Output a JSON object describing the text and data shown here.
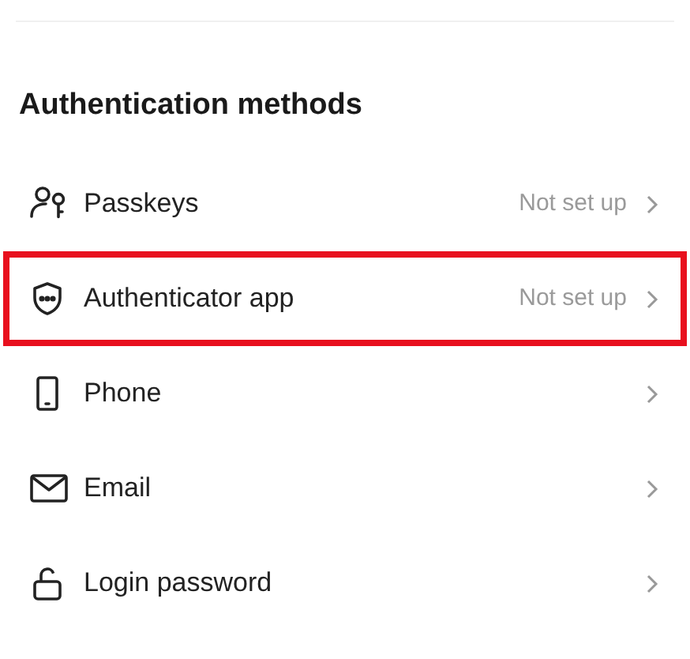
{
  "section": {
    "title": "Authentication methods"
  },
  "methods": [
    {
      "kind": "passkey",
      "label": "Passkeys",
      "status": "Not set up",
      "highlighted": false
    },
    {
      "kind": "shield",
      "label": "Authenticator app",
      "status": "Not set up",
      "highlighted": true
    },
    {
      "kind": "phone",
      "label": "Phone",
      "highlighted": false
    },
    {
      "kind": "mail",
      "label": "Email",
      "highlighted": false
    },
    {
      "kind": "lock",
      "label": "Login password",
      "highlighted": false
    }
  ]
}
